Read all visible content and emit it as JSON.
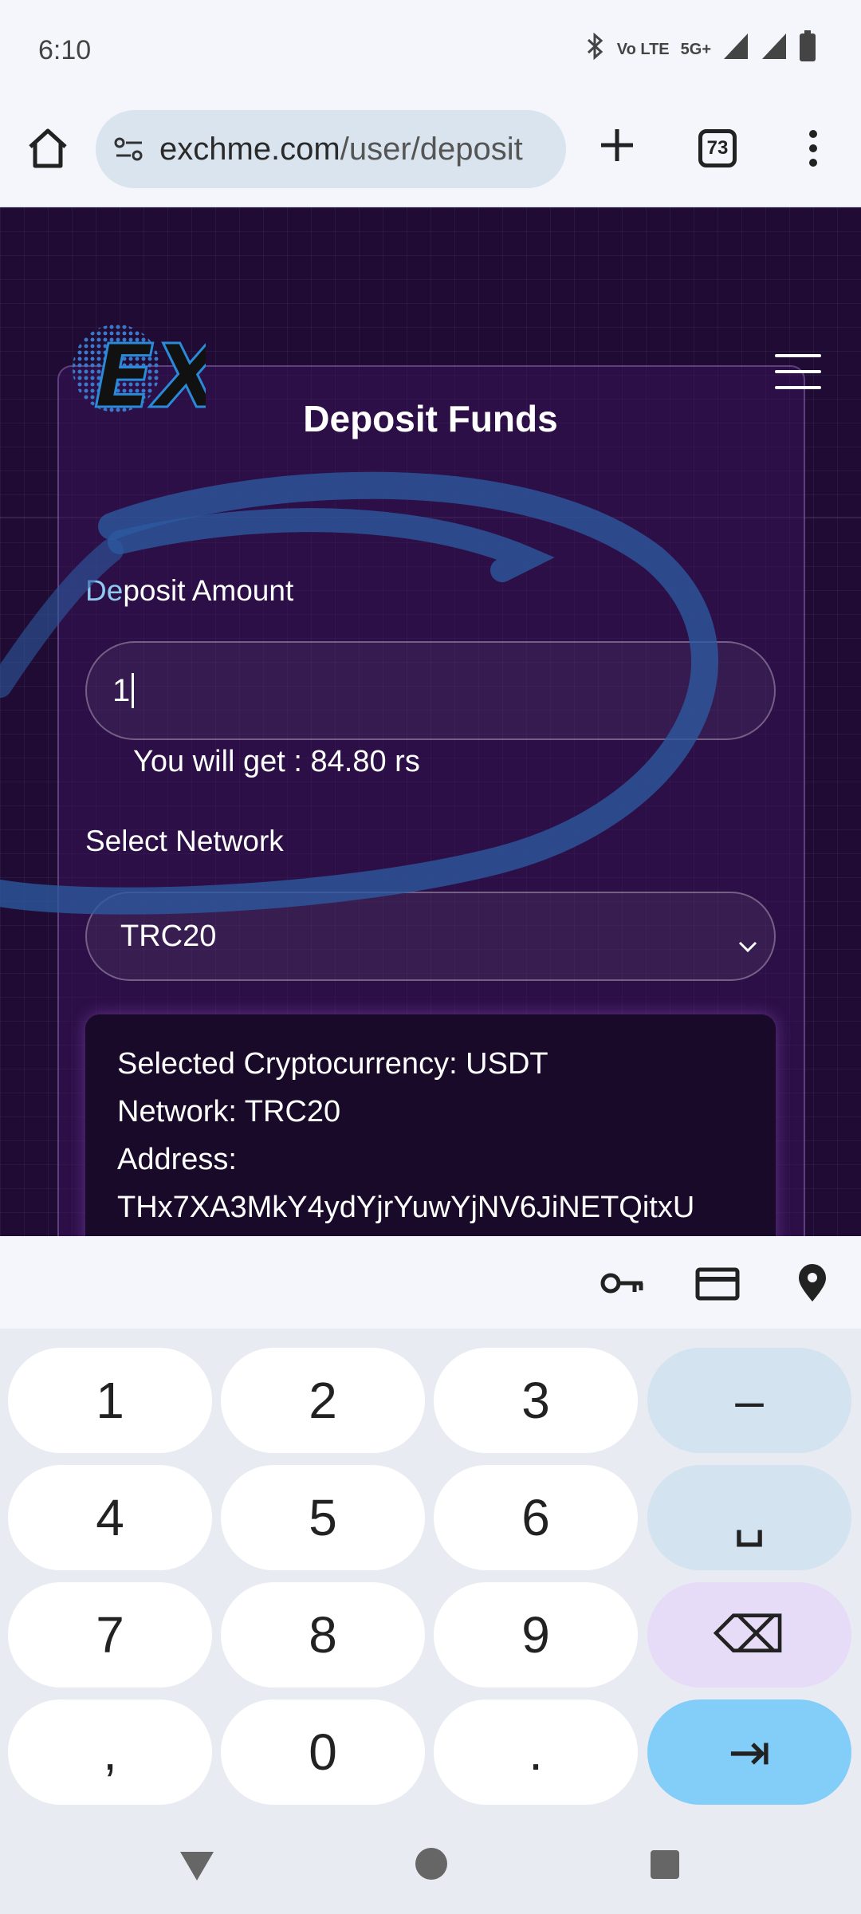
{
  "status_bar": {
    "time": "6:10",
    "net_label": "Vo LTE",
    "signal_label": "5G+"
  },
  "browser": {
    "url_domain": "exchme.com",
    "url_path": "/user/deposit",
    "tab_count": "73"
  },
  "page": {
    "logo_text": "EX",
    "title": "Deposit Funds",
    "amount_label_first": "De",
    "amount_label_rest": "posit Amount",
    "amount_value": "1",
    "you_get": "You will get : 84.80 rs",
    "network_label": "Select Network",
    "network_selected": "TRC20",
    "info": {
      "crypto": "Selected Cryptocurrency: USDT",
      "network": "Network: TRC20",
      "address_label": "Address:",
      "address": "THx7XA3MkY4ydYjrYuwYjNV6JiNETQitxU"
    }
  },
  "keyboard": {
    "rows": [
      [
        "1",
        "2",
        "3",
        "–"
      ],
      [
        "4",
        "5",
        "6",
        "␣"
      ],
      [
        "7",
        "8",
        "9",
        "⌫"
      ],
      [
        ",",
        "0",
        ".",
        "⇥"
      ]
    ]
  },
  "colors": {
    "page_bg": "#1f0b33",
    "accent_blue": "#82cef8",
    "scribble": "#2d5aa0"
  }
}
